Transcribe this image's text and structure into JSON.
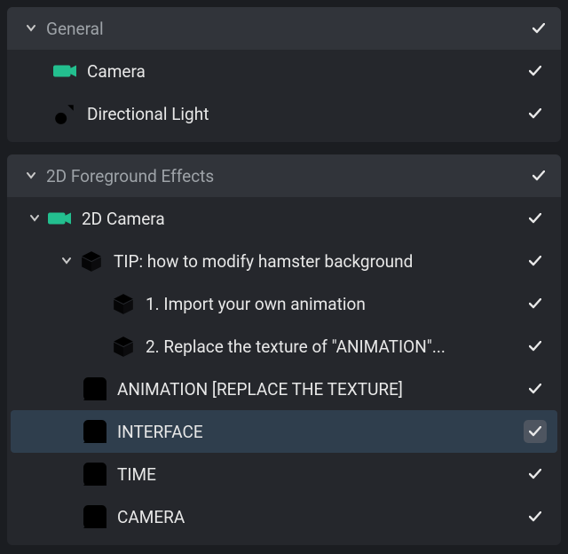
{
  "sections": [
    {
      "title": "General"
    },
    {
      "title": "2D Foreground Effects"
    }
  ],
  "rows": {
    "camera": "Camera",
    "dlight": "Directional Light",
    "cam2d": "2D Camera",
    "tip": "TIP: how to modify hamster background",
    "step1": "1. Import your own animation",
    "step2": "2. Replace the texture of \"ANIMATION\"...",
    "anim": "ANIMATION [REPLACE THE TEXTURE]",
    "interface": "INTERFACE",
    "time": "TIME",
    "cameraImg": "CAMERA"
  }
}
